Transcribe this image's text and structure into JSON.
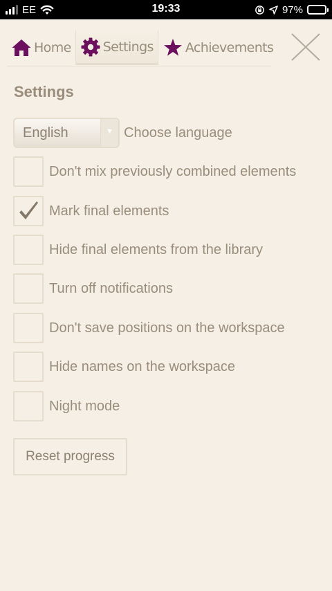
{
  "status_bar": {
    "carrier": "EE",
    "time": "19:33",
    "battery": "97%",
    "battery_level": 0.97
  },
  "tabs": [
    {
      "label": "Home",
      "icon": "home-icon",
      "active": false
    },
    {
      "label": "Settings",
      "icon": "gear-icon",
      "active": true
    },
    {
      "label": "Achievements",
      "icon": "star-icon",
      "active": false
    }
  ],
  "accent_color": "#6b0f5e",
  "settings": {
    "title": "Settings",
    "language": {
      "value": "English",
      "label": "Choose language"
    },
    "options": [
      {
        "label": "Don't mix previously combined elements",
        "checked": false
      },
      {
        "label": "Mark final elements",
        "checked": true
      },
      {
        "label": "Hide final elements from the library",
        "checked": false
      },
      {
        "label": "Turn off notifications",
        "checked": false
      },
      {
        "label": "Don't save positions on the workspace",
        "checked": false
      },
      {
        "label": "Hide names on the workspace",
        "checked": false
      },
      {
        "label": "Night mode",
        "checked": false
      }
    ],
    "reset_label": "Reset progress"
  }
}
